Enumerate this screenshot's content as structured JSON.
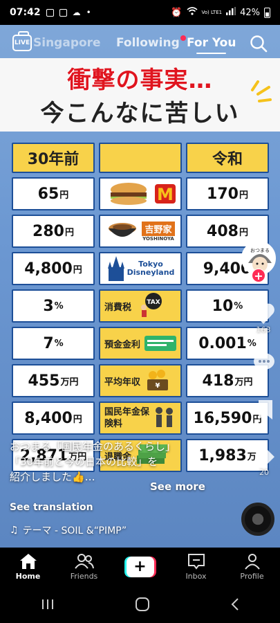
{
  "status": {
    "time": "07:42",
    "battery": "42%",
    "network": "Vo) LTE1"
  },
  "topnav": {
    "live_label": "LIVE",
    "tabs": [
      {
        "label": "Singapore"
      },
      {
        "label": "Following"
      },
      {
        "label": "For You"
      }
    ]
  },
  "video": {
    "headline_line1": "衝撃の事実…",
    "headline_line2": "今こんなに苦しい",
    "table": {
      "header_left": "30年前",
      "header_right": "令和",
      "rows": [
        {
          "old": "65",
          "old_unit": "円",
          "item": "McDonald's hamburger",
          "item_label": "",
          "new": "170",
          "new_unit": "円"
        },
        {
          "old": "280",
          "old_unit": "円",
          "item": "吉野家",
          "item_label": "吉野家",
          "new": "408",
          "new_unit": "円"
        },
        {
          "old": "4,800",
          "old_unit": "円",
          "item": "Tokyo Disneyland",
          "item_label": "Tokyo Disneyland",
          "new": "9,400",
          "new_unit": ""
        },
        {
          "old": "3",
          "old_unit": "%",
          "item": "消費税",
          "item_label": "消費税",
          "new": "10",
          "new_unit": "%"
        },
        {
          "old": "7",
          "old_unit": "%",
          "item": "預金金利",
          "item_label": "預金金利",
          "new": "0.001",
          "new_unit": "%"
        },
        {
          "old": "455",
          "old_unit": "万円",
          "item": "平均年収",
          "item_label": "平均年収",
          "new": "418",
          "new_unit": "万円"
        },
        {
          "old": "8,400",
          "old_unit": "円",
          "item": "国民年金保険料",
          "item_label": "国民年金保険料",
          "new": "16,590",
          "new_unit": "円"
        },
        {
          "old": "2,871",
          "old_unit": "万円",
          "item": "退職金",
          "item_label": "退職金",
          "new": "1,983",
          "new_unit": "万"
        }
      ]
    },
    "tax_badge": "TAX",
    "yoshinoya_sub": "YOSHINOYA"
  },
  "rail": {
    "like_count": "163",
    "comment_count": "",
    "share_count": "20",
    "avatar_text": "おつまる"
  },
  "caption": {
    "line1": "おつまる「国民年金のあるくらし」",
    "line2": "「30年前と今の日本の比較」を",
    "line3": "紹介しました👍…",
    "see_more": "See more",
    "see_translation": "See translation",
    "music": "テーマ - SOIL &“PIMP”"
  },
  "bottomnav": {
    "items": [
      {
        "label": "Home"
      },
      {
        "label": "Friends"
      },
      {
        "label": ""
      },
      {
        "label": "Inbox"
      },
      {
        "label": "Profile"
      }
    ]
  },
  "colors": {
    "accent": "#fe2c55",
    "cyan": "#25f4ee",
    "grid_yellow": "#f8d24a",
    "grid_border": "#1d4f98",
    "headline_red": "#e0151f"
  }
}
